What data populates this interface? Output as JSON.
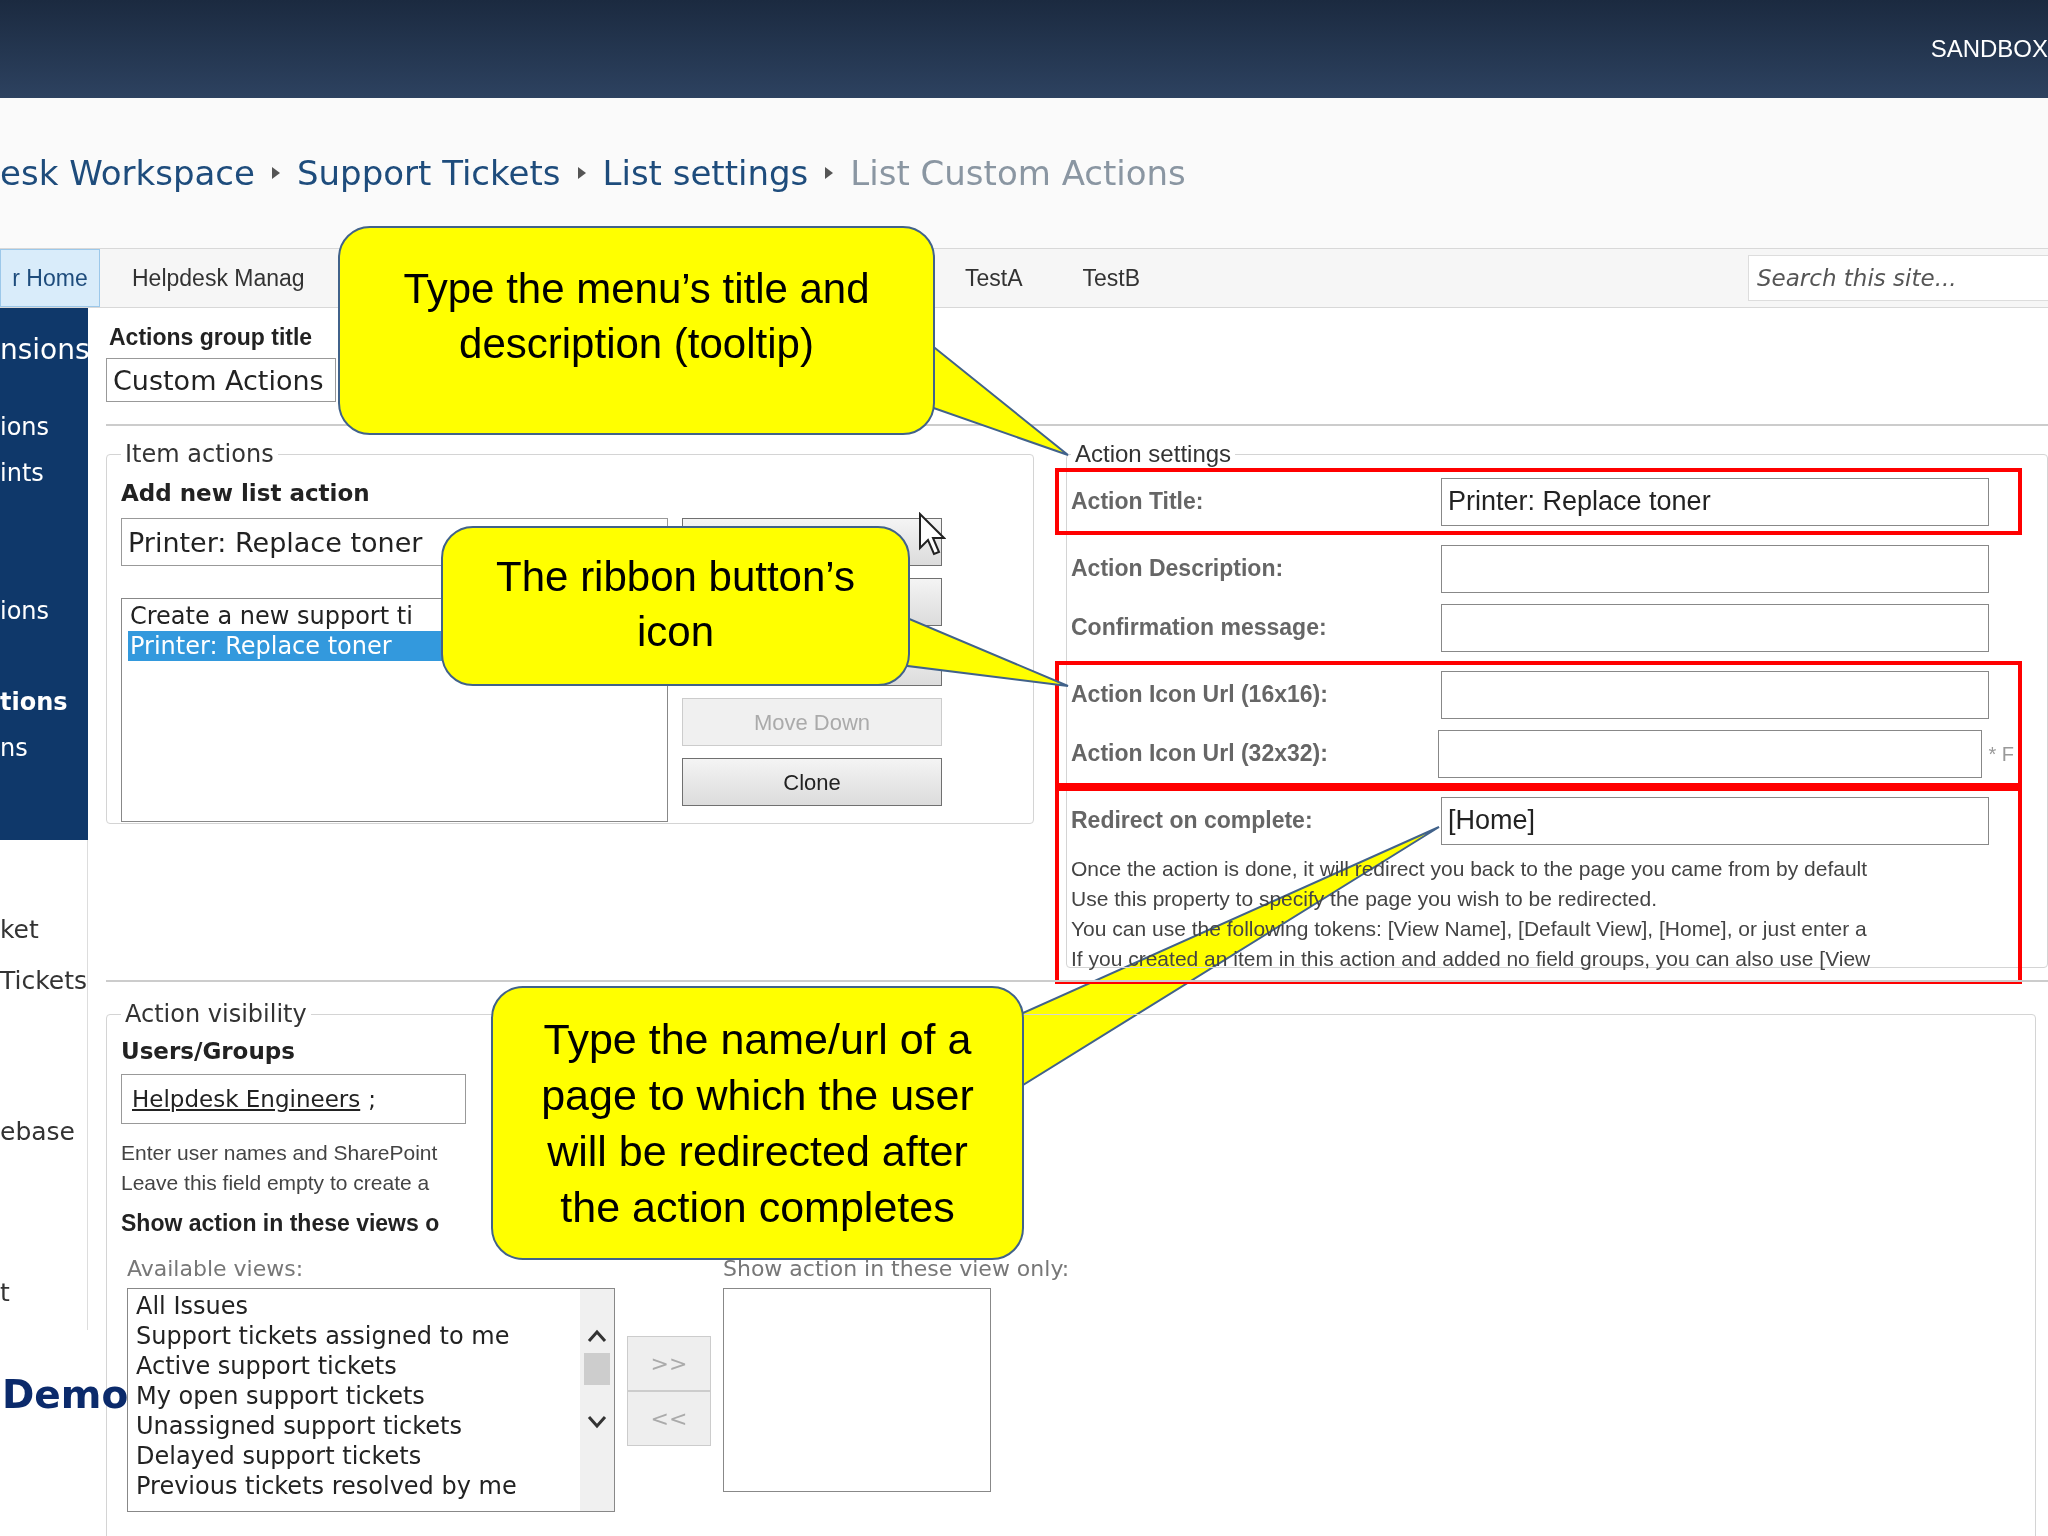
{
  "top_bar": {
    "site_label": "SANDBOX"
  },
  "breadcrumb": [
    "esk Workspace",
    "Support Tickets",
    "List settings",
    "List Custom Actions"
  ],
  "nav_tabs": [
    {
      "label": "r Home",
      "selected": true
    },
    {
      "label": "Helpdesk Manag",
      "selected": false
    },
    {
      "label": "TestA",
      "selected": false
    },
    {
      "label": "TestB",
      "selected": false
    }
  ],
  "search": {
    "placeholder": "Search this site..."
  },
  "sidebar": {
    "dark_items": [
      {
        "label": "nsions",
        "kind": "heading"
      },
      {
        "label": "ions",
        "kind": "link"
      },
      {
        "label": "ints",
        "kind": "link"
      },
      {
        "label": "ions",
        "kind": "link"
      },
      {
        "label": "tions",
        "kind": "current"
      },
      {
        "label": "ns",
        "kind": "link"
      }
    ],
    "light_items": [
      "ket",
      "Tickets",
      "ebase",
      "t"
    ]
  },
  "actions_group": {
    "label": "Actions group title",
    "value": "Custom Actions"
  },
  "item_actions": {
    "legend": "Item actions",
    "heading": "Add new list action",
    "new_action_value": "Printer: Replace toner",
    "actions": [
      {
        "label": "Create a new support ti",
        "selected": false
      },
      {
        "label": "Printer: Replace toner",
        "selected": true
      }
    ],
    "buttons": [
      {
        "disabled": false
      },
      {
        "disabled": false
      },
      {
        "disabled": false
      },
      {
        "label": "Move Down",
        "disabled": true
      },
      {
        "label": "Clone",
        "disabled": false
      }
    ]
  },
  "action_settings": {
    "legend": "Action settings",
    "groups": [
      {
        "highlighted": true,
        "rows": [
          {
            "label": "Action Title:",
            "value": "Printer: Replace toner"
          }
        ]
      },
      {
        "highlighted": false,
        "rows": [
          {
            "label": "Action Description:"
          },
          {
            "label": "Confirmation message:"
          }
        ]
      },
      {
        "highlighted": true,
        "rows": [
          {
            "label": "Action Icon Url (16x16):"
          },
          {
            "label": "Action Icon Url (32x32):",
            "note": "* F"
          }
        ]
      },
      {
        "highlighted": true,
        "rows": [
          {
            "label": "Redirect on complete:",
            "value": "[Home]"
          }
        ],
        "help": [
          "Once the action is done, it will redirect you back to the page you came from by default",
          "Use this property to specify the page you wish to be redirected.",
          "You can use the following tokens: [View Name], [Default View], [Home], or just enter a",
          "If you created an item in this action and added no field groups, you can also use [View"
        ]
      }
    ]
  },
  "action_visibility": {
    "legend": "Action visibility",
    "users_label": "Users/Groups",
    "resolved_names": [
      "Helpdesk Engineers"
    ],
    "separator": ";",
    "help": [
      "Enter user names and SharePoint",
      "Leave this field empty to create a"
    ],
    "views_heading": "Show action in these views o",
    "available_label": "Available views:",
    "available_views": [
      "All Issues",
      "Support tickets assigned to me",
      "Active support tickets",
      "My open support tickets",
      "Unassigned support tickets",
      "Delayed support tickets",
      "Previous tickets resolved by me"
    ],
    "selected_label": "Show action in these view only:",
    "move_buttons": [
      {
        "label": ">>",
        "disabled": true
      },
      {
        "label": "<<",
        "disabled": true
      }
    ]
  },
  "callouts": [
    "Type the menu’s title and description (tooltip)",
    "The ribbon button’s icon",
    "Type the name/url of a page to which the user will be redirected after the action completes"
  ],
  "overlay_label": "Demo"
}
